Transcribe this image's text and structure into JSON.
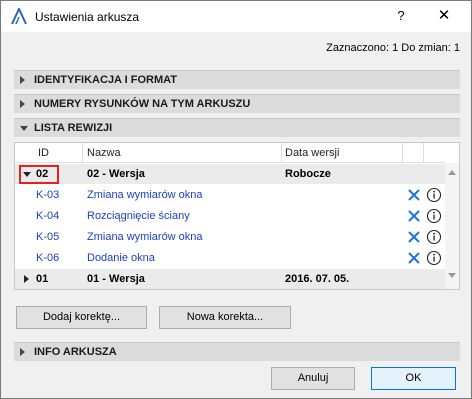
{
  "window": {
    "title": "Ustawienia arkusza",
    "help_glyph": "?",
    "close_glyph": "✕"
  },
  "selection_info": "Zaznaczono: 1 Do zmian: 1",
  "sections": {
    "identification": "IDENTYFIKACJA I FORMAT",
    "drawing_numbers": "NUMERY RYSUNKÓW NA TYM ARKUSZU",
    "revision_list": "LISTA REWIZJI",
    "sheet_info": "INFO ARKUSZA"
  },
  "table": {
    "headers": {
      "id": "ID",
      "name": "Nazwa",
      "date": "Data wersji"
    },
    "rows": [
      {
        "type": "group",
        "expanded": true,
        "id": "02",
        "name": "02 - Wersja",
        "date": "Robocze"
      },
      {
        "type": "item",
        "id": "K-03",
        "name": "Zmiana wymiarów okna"
      },
      {
        "type": "item",
        "id": "K-04",
        "name": "Rozciągnięcie ściany"
      },
      {
        "type": "item",
        "id": "K-05",
        "name": "Zmiana wymiarów okna"
      },
      {
        "type": "item",
        "id": "K-06",
        "name": "Dodanie okna"
      },
      {
        "type": "group",
        "expanded": false,
        "id": "01",
        "name": "01 - Wersja",
        "date": "2016. 07. 05."
      }
    ]
  },
  "buttons": {
    "add_correction": "Dodaj korektę...",
    "new_correction": "Nowa korekta...",
    "cancel": "Anuluj",
    "ok": "OK"
  },
  "colors": {
    "link": "#1c3fbf",
    "icon_blue": "#1e73d6",
    "highlight_red": "#e2231a"
  },
  "icons": {
    "remove": "x-icon",
    "info": "info-icon",
    "app": "archicad-icon"
  }
}
